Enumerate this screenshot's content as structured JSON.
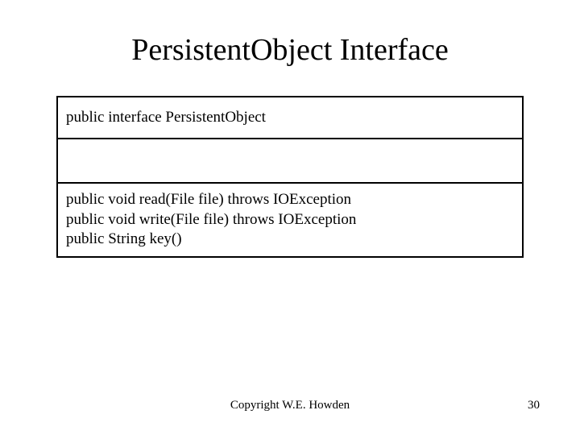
{
  "slide": {
    "title": "PersistentObject Interface",
    "uml": {
      "header": "public interface PersistentObject",
      "method1": "public void read(File file) throws IOException",
      "method2": "public void write(File file) throws IOException",
      "method3": "public String key()"
    },
    "copyright": "Copyright W.E. Howden",
    "page_number": "30"
  }
}
